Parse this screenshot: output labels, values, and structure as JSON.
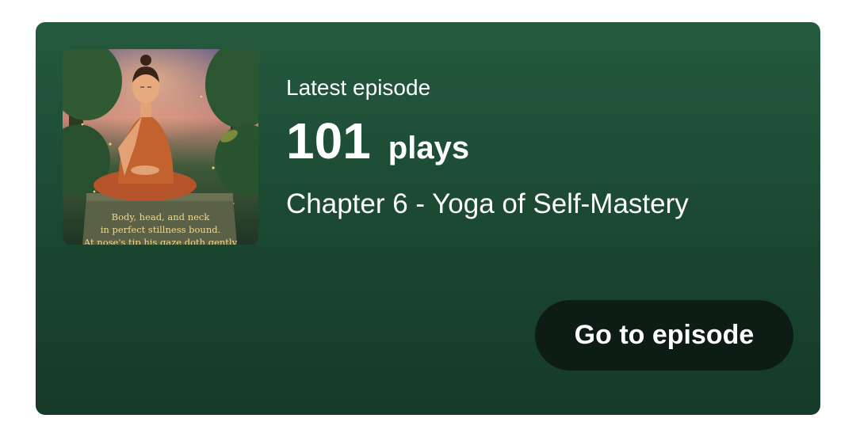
{
  "episode_card": {
    "label": "Latest episode",
    "plays_count": "101",
    "plays_unit": "plays",
    "title": "Chapter 6 - Yoga of Self-Mastery",
    "button_label": "Go to episode",
    "cover": {
      "icon": "meditating-monk-artwork",
      "caption": "Body, head, and neck\nin perfect stillness bound.\nAt nose's tip his gaze doth gently"
    }
  },
  "colors": {
    "card_top": "#245a3e",
    "card_bottom": "#153a28",
    "button_bg": "#0d1c14",
    "text": "#ffffff",
    "caption_gold": "#f0d98c"
  }
}
